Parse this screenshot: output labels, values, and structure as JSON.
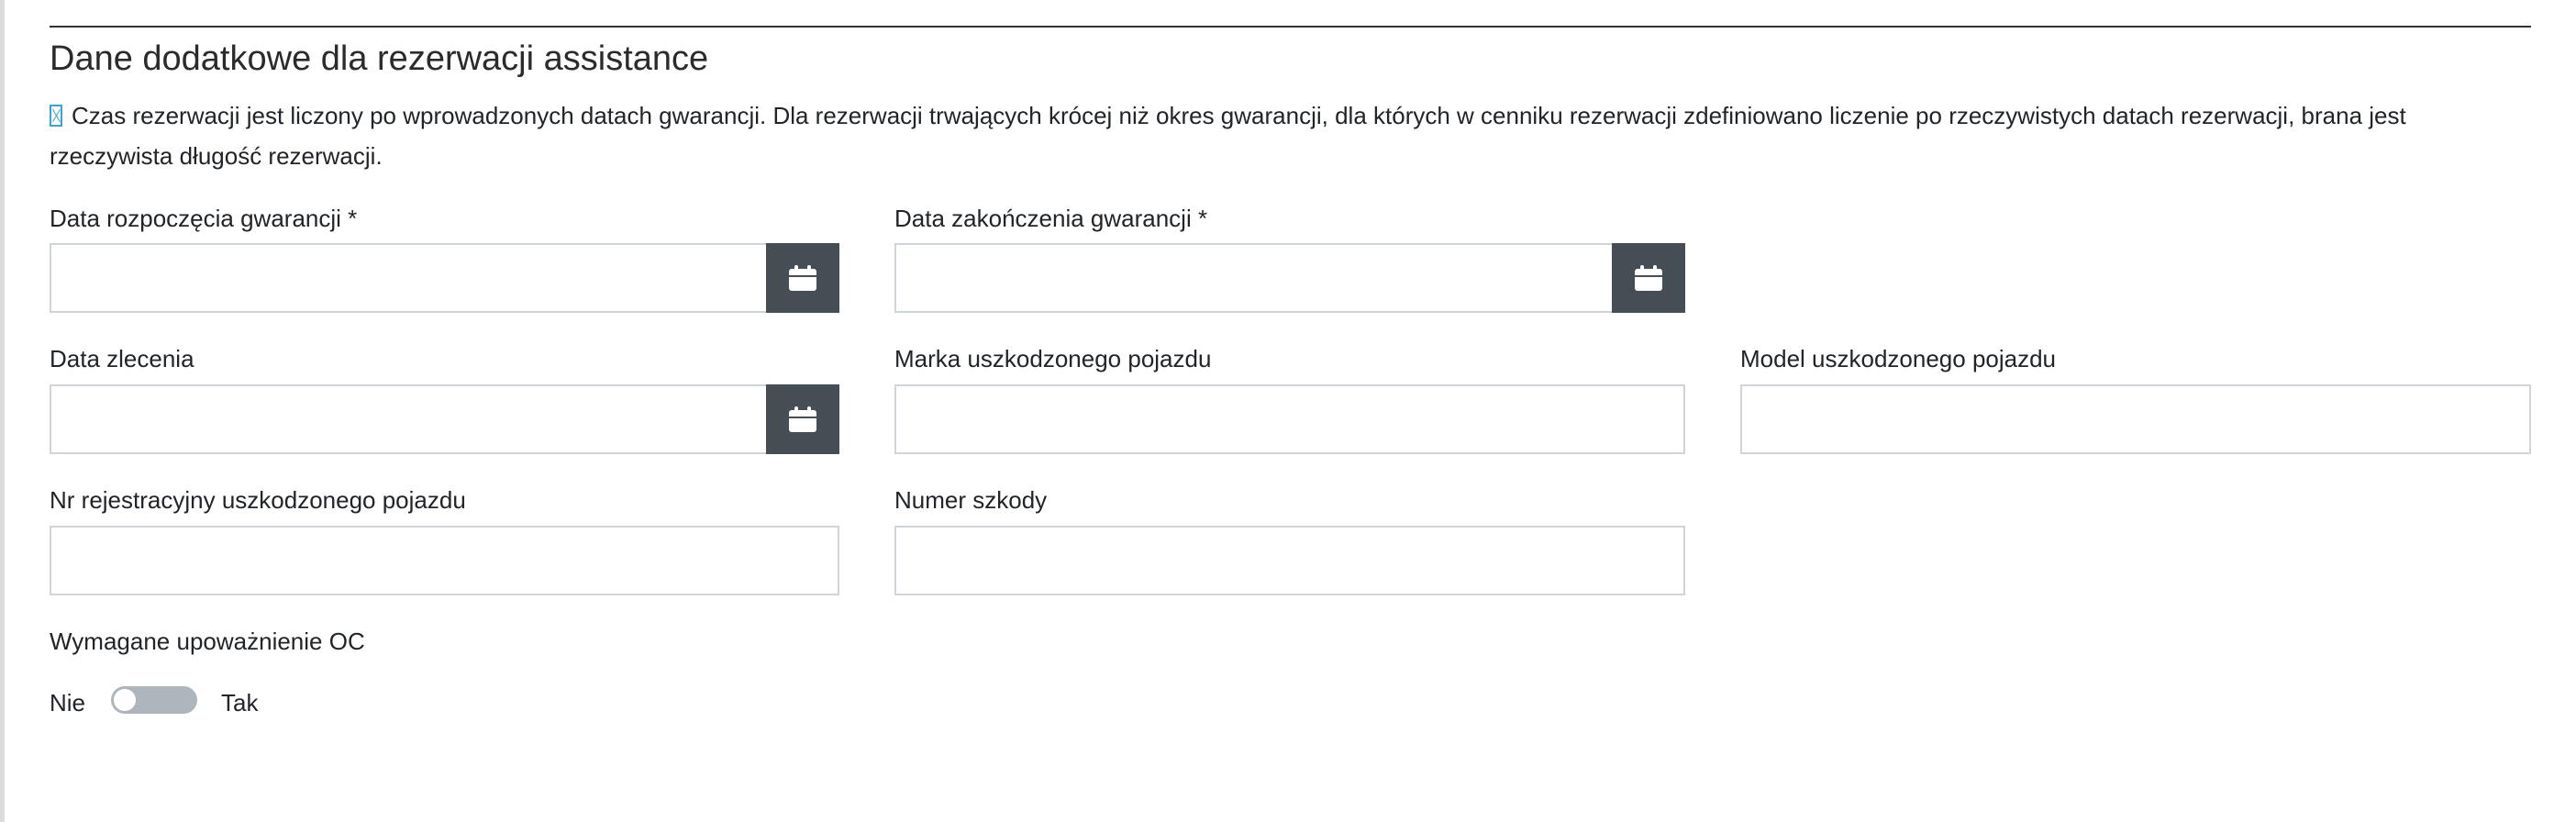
{
  "section": {
    "title": "Dane dodatkowe dla rezerwacji assistance",
    "info_icon": "info-icon",
    "info_text": "Czas rezerwacji jest liczony po wprowadzonych datach gwarancji. Dla rezerwacji trwających krócej niż okres gwarancji, dla których w cenniku rezerwacji zdefiniowano liczenie po rzeczywistych datach rezerwacji, brana jest rzeczywista długość rezerwacji."
  },
  "fields": {
    "warranty_start": {
      "label": "Data rozpoczęcia gwarancji *",
      "value": "",
      "button_icon": "calendar-icon"
    },
    "warranty_end": {
      "label": "Data zakończenia gwarancji *",
      "value": "",
      "button_icon": "calendar-icon"
    },
    "order_date": {
      "label": "Data zlecenia",
      "value": "",
      "button_icon": "calendar-icon"
    },
    "vehicle_make": {
      "label": "Marka uszkodzonego pojazdu",
      "value": ""
    },
    "vehicle_model": {
      "label": "Model uszkodzonego pojazdu",
      "value": ""
    },
    "vehicle_registration": {
      "label": "Nr rejestracyjny uszkodzonego pojazdu",
      "value": ""
    },
    "claim_number": {
      "label": "Numer szkody",
      "value": ""
    }
  },
  "oc_authorization": {
    "label": "Wymagane upoważnienie OC",
    "off_label": "Nie",
    "on_label": "Tak",
    "value": false
  },
  "colors": {
    "calendar_button": "#454d55",
    "toggle_off": "#adb5bd",
    "info_icon": "#3aa3cf"
  }
}
